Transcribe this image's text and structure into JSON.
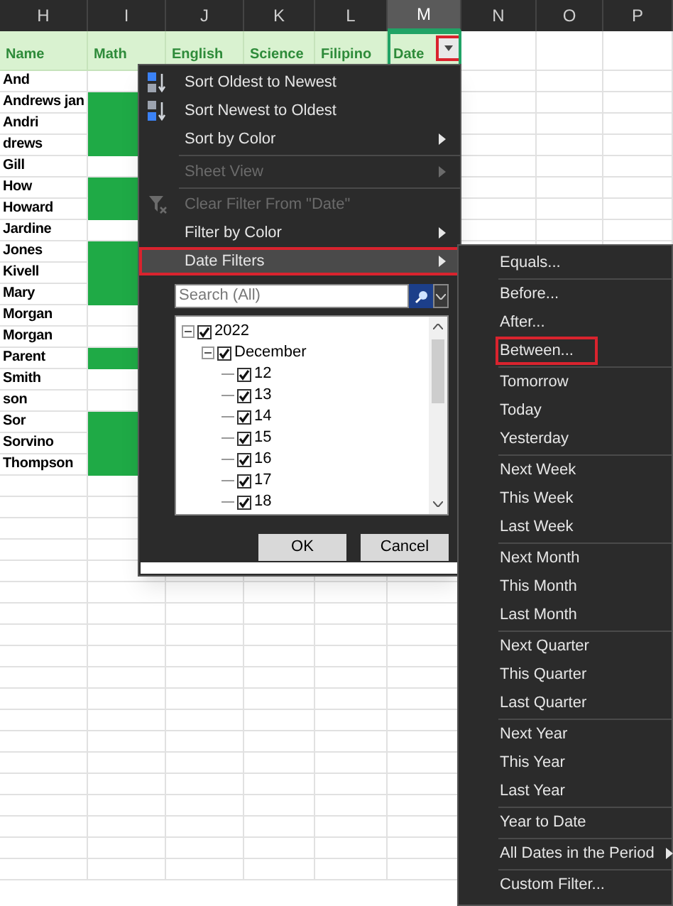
{
  "columns": [
    {
      "label": "H",
      "selected": false
    },
    {
      "label": "I",
      "selected": false
    },
    {
      "label": "J",
      "selected": false
    },
    {
      "label": "K",
      "selected": false
    },
    {
      "label": "L",
      "selected": false
    },
    {
      "label": "M",
      "selected": true
    },
    {
      "label": "N",
      "selected": false
    },
    {
      "label": "O",
      "selected": false
    },
    {
      "label": "P",
      "selected": false
    }
  ],
  "header_row": [
    "Name",
    "Math",
    "English",
    "Science",
    "Filipino",
    "Date"
  ],
  "filter_button": {
    "highlight_box": true
  },
  "rows": [
    {
      "name": "And",
      "math_filled": false
    },
    {
      "name": "Andrews jan",
      "math_filled": true
    },
    {
      "name": "Andri",
      "math_filled": true
    },
    {
      "name": "drews",
      "math_filled": true
    },
    {
      "name": "Gill",
      "math_filled": false
    },
    {
      "name": "How",
      "math_filled": true
    },
    {
      "name": "Howard",
      "math_filled": true
    },
    {
      "name": "Jardine",
      "math_filled": false
    },
    {
      "name": "Jones",
      "math_filled": true
    },
    {
      "name": "Kivell",
      "math_filled": true
    },
    {
      "name": "Mary",
      "math_filled": true
    },
    {
      "name": "Morgan",
      "math_filled": false
    },
    {
      "name": "Morgan",
      "math_filled": false
    },
    {
      "name": "Parent",
      "math_filled": true
    },
    {
      "name": "Smith",
      "math_filled": false
    },
    {
      "name": "son",
      "math_filled": false
    },
    {
      "name": "Sor",
      "math_filled": true
    },
    {
      "name": "Sorvino",
      "math_filled": true
    },
    {
      "name": "Thompson",
      "math_filled": true
    }
  ],
  "filter_menu": {
    "items": [
      {
        "kind": "sort-asc",
        "label": "Sort Oldest to Newest",
        "disabled": false,
        "submenu": false,
        "highlight_box": false
      },
      {
        "kind": "sort-desc",
        "label": "Sort Newest to Oldest",
        "disabled": false,
        "submenu": false,
        "highlight_box": false
      },
      {
        "kind": "item",
        "label": "Sort by Color",
        "disabled": false,
        "submenu": true,
        "highlight_box": false
      },
      {
        "kind": "separator"
      },
      {
        "kind": "item",
        "label": "Sheet View",
        "disabled": true,
        "submenu": true,
        "highlight_box": false
      },
      {
        "kind": "separator"
      },
      {
        "kind": "clear",
        "label": "Clear Filter From \"Date\"",
        "disabled": true,
        "submenu": false,
        "highlight_box": false
      },
      {
        "kind": "item",
        "label": "Filter by Color",
        "disabled": false,
        "submenu": true,
        "highlight_box": false
      },
      {
        "kind": "item",
        "label": "Date Filters",
        "disabled": false,
        "submenu": true,
        "highlight_box": true
      }
    ],
    "search": {
      "placeholder": "Search (All)"
    },
    "tree": [
      {
        "label": "2022",
        "checked": true,
        "expanded": true,
        "children": [
          {
            "label": "December",
            "checked": true,
            "expanded": true,
            "children": [
              {
                "label": "12",
                "checked": true
              },
              {
                "label": "13",
                "checked": true
              },
              {
                "label": "14",
                "checked": true
              },
              {
                "label": "15",
                "checked": true
              },
              {
                "label": "16",
                "checked": true
              },
              {
                "label": "17",
                "checked": true
              },
              {
                "label": "18",
                "checked": true
              }
            ]
          }
        ]
      }
    ],
    "buttons": [
      "OK",
      "Cancel"
    ]
  },
  "date_filters_menu": {
    "items": [
      {
        "kind": "item",
        "label": "Equals...",
        "submenu": false,
        "highlight_box": false
      },
      {
        "kind": "separator"
      },
      {
        "kind": "item",
        "label": "Before...",
        "submenu": false,
        "highlight_box": false
      },
      {
        "kind": "item",
        "label": "After...",
        "submenu": false,
        "highlight_box": false
      },
      {
        "kind": "item",
        "label": "Between...",
        "submenu": false,
        "highlight_box": true
      },
      {
        "kind": "separator"
      },
      {
        "kind": "item",
        "label": "Tomorrow",
        "submenu": false,
        "highlight_box": false
      },
      {
        "kind": "item",
        "label": "Today",
        "submenu": false,
        "highlight_box": false
      },
      {
        "kind": "item",
        "label": "Yesterday",
        "submenu": false,
        "highlight_box": false
      },
      {
        "kind": "separator"
      },
      {
        "kind": "item",
        "label": "Next Week",
        "submenu": false,
        "highlight_box": false
      },
      {
        "kind": "item",
        "label": "This Week",
        "submenu": false,
        "highlight_box": false
      },
      {
        "kind": "item",
        "label": "Last Week",
        "submenu": false,
        "highlight_box": false
      },
      {
        "kind": "separator"
      },
      {
        "kind": "item",
        "label": "Next Month",
        "submenu": false,
        "highlight_box": false
      },
      {
        "kind": "item",
        "label": "This Month",
        "submenu": false,
        "highlight_box": false
      },
      {
        "kind": "item",
        "label": "Last Month",
        "submenu": false,
        "highlight_box": false
      },
      {
        "kind": "separator"
      },
      {
        "kind": "item",
        "label": "Next Quarter",
        "submenu": false,
        "highlight_box": false
      },
      {
        "kind": "item",
        "label": "This Quarter",
        "submenu": false,
        "highlight_box": false
      },
      {
        "kind": "item",
        "label": "Last Quarter",
        "submenu": false,
        "highlight_box": false
      },
      {
        "kind": "separator"
      },
      {
        "kind": "item",
        "label": "Next Year",
        "submenu": false,
        "highlight_box": false
      },
      {
        "kind": "item",
        "label": "This Year",
        "submenu": false,
        "highlight_box": false
      },
      {
        "kind": "item",
        "label": "Last Year",
        "submenu": false,
        "highlight_box": false
      },
      {
        "kind": "separator"
      },
      {
        "kind": "item",
        "label": "Year to Date",
        "submenu": false,
        "highlight_box": false
      },
      {
        "kind": "separator"
      },
      {
        "kind": "item",
        "label": "All Dates in the Period",
        "submenu": true,
        "highlight_box": false
      },
      {
        "kind": "separator"
      },
      {
        "kind": "item",
        "label": "Custom Filter...",
        "submenu": false,
        "highlight_box": false
      }
    ]
  }
}
